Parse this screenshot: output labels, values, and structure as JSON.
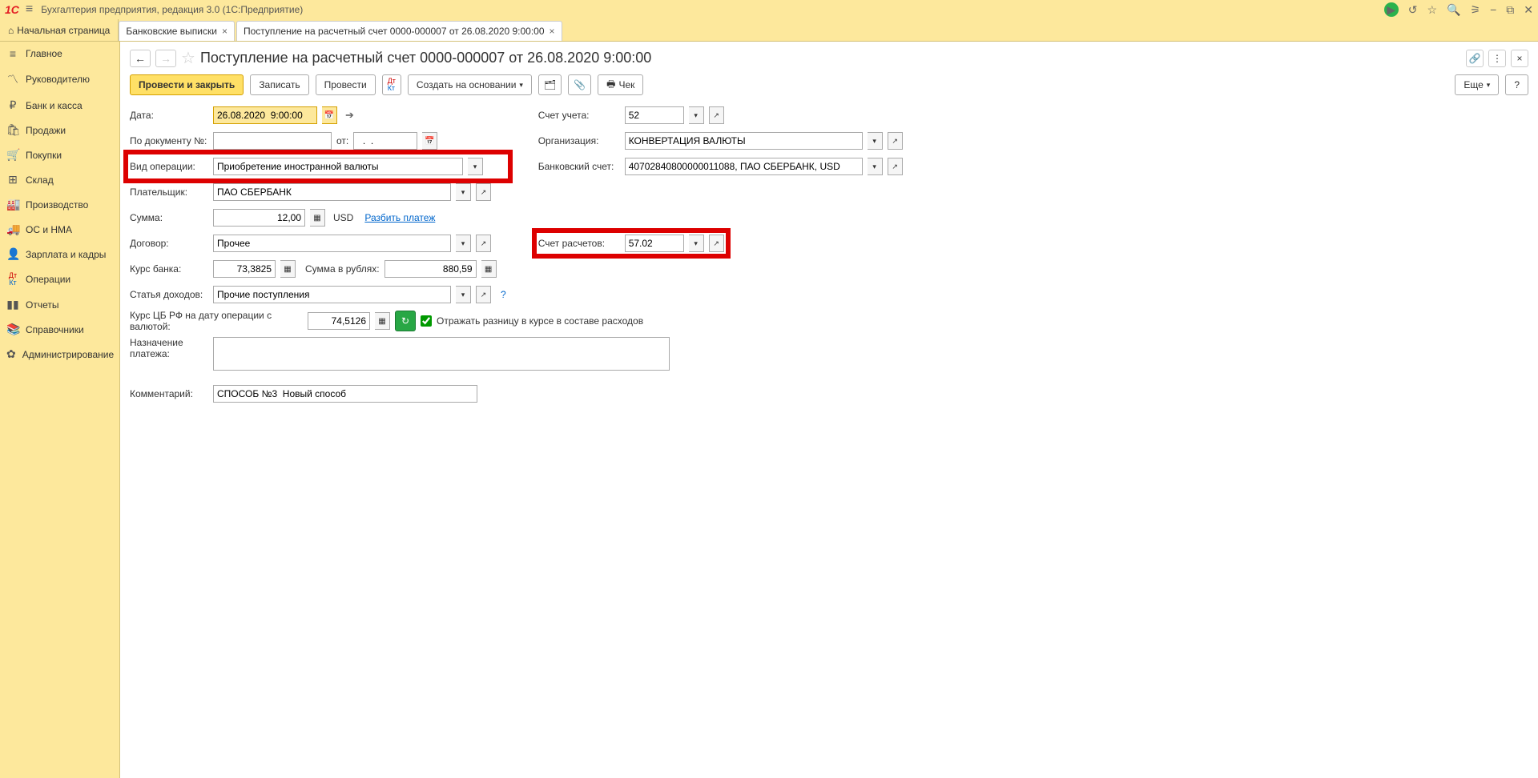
{
  "titlebar": {
    "logo": "1C",
    "app_name": "Бухгалтерия предприятия, редакция 3.0  (1С:Предприятие)"
  },
  "tabs": {
    "home": "Начальная страница",
    "t1": "Банковские выписки",
    "t2": "Поступление на расчетный счет 0000-000007 от 26.08.2020 9:00:00"
  },
  "sidebar": {
    "items": [
      {
        "icon": "≡",
        "label": "Главное"
      },
      {
        "icon": "📈",
        "label": "Руководителю"
      },
      {
        "icon": "₽",
        "label": "Банк и касса"
      },
      {
        "icon": "🛍",
        "label": "Продажи"
      },
      {
        "icon": "🛒",
        "label": "Покупки"
      },
      {
        "icon": "📊",
        "label": "Склад"
      },
      {
        "icon": "🏭",
        "label": "Производство"
      },
      {
        "icon": "🚚",
        "label": "ОС и НМА"
      },
      {
        "icon": "👤",
        "label": "Зарплата и кадры"
      },
      {
        "icon": "Дт",
        "label": "Операции"
      },
      {
        "icon": "📊",
        "label": "Отчеты"
      },
      {
        "icon": "📚",
        "label": "Справочники"
      },
      {
        "icon": "⚙",
        "label": "Администрирование"
      }
    ]
  },
  "header": {
    "title": "Поступление на расчетный счет 0000-000007 от 26.08.2020 9:00:00"
  },
  "toolbar": {
    "btn_post_close": "Провести и закрыть",
    "btn_save": "Записать",
    "btn_post": "Провести",
    "btn_create_based": "Создать на основании",
    "btn_check": "Чек",
    "btn_more": "Еще"
  },
  "form": {
    "date_lbl": "Дата:",
    "date_val": "26.08.2020  9:00:00",
    "acct_lbl": "Счет учета:",
    "acct_val": "52",
    "doc_no_lbl": "По документу №:",
    "doc_no_from": "от:",
    "doc_no_from_val": "  .  .    ",
    "org_lbl": "Организация:",
    "org_val": "КОНВЕРТАЦИЯ ВАЛЮТЫ",
    "op_type_lbl": "Вид операции:",
    "op_type_val": "Приобретение иностранной валюты",
    "bank_acct_lbl": "Банковский счет:",
    "bank_acct_val": "40702840800000011088, ПАО СБЕРБАНК, USD",
    "payer_lbl": "Плательщик:",
    "payer_val": "ПАО СБЕРБАНК",
    "sum_lbl": "Сумма:",
    "sum_val": "12,00",
    "sum_cur": "USD",
    "split_link": "Разбить платеж",
    "contract_lbl": "Договор:",
    "contract_val": "Прочее",
    "settle_acct_lbl": "Счет расчетов:",
    "settle_acct_val": "57.02",
    "bank_rate_lbl": "Курс банка:",
    "bank_rate_val": "73,3825",
    "rub_sum_lbl": "Сумма в рублях:",
    "rub_sum_val": "880,59",
    "income_item_lbl": "Статья доходов:",
    "income_item_val": "Прочие поступления",
    "cbrf_lbl": "Курс ЦБ РФ на дату операции с валютой:",
    "cbrf_val": "74,5126",
    "chk_label": "Отражать разницу в курсе в составе расходов",
    "purpose_lbl": "Назначение платежа:",
    "comment_lbl": "Комментарий:",
    "comment_val": "СПОСОБ №3  Новый способ"
  }
}
